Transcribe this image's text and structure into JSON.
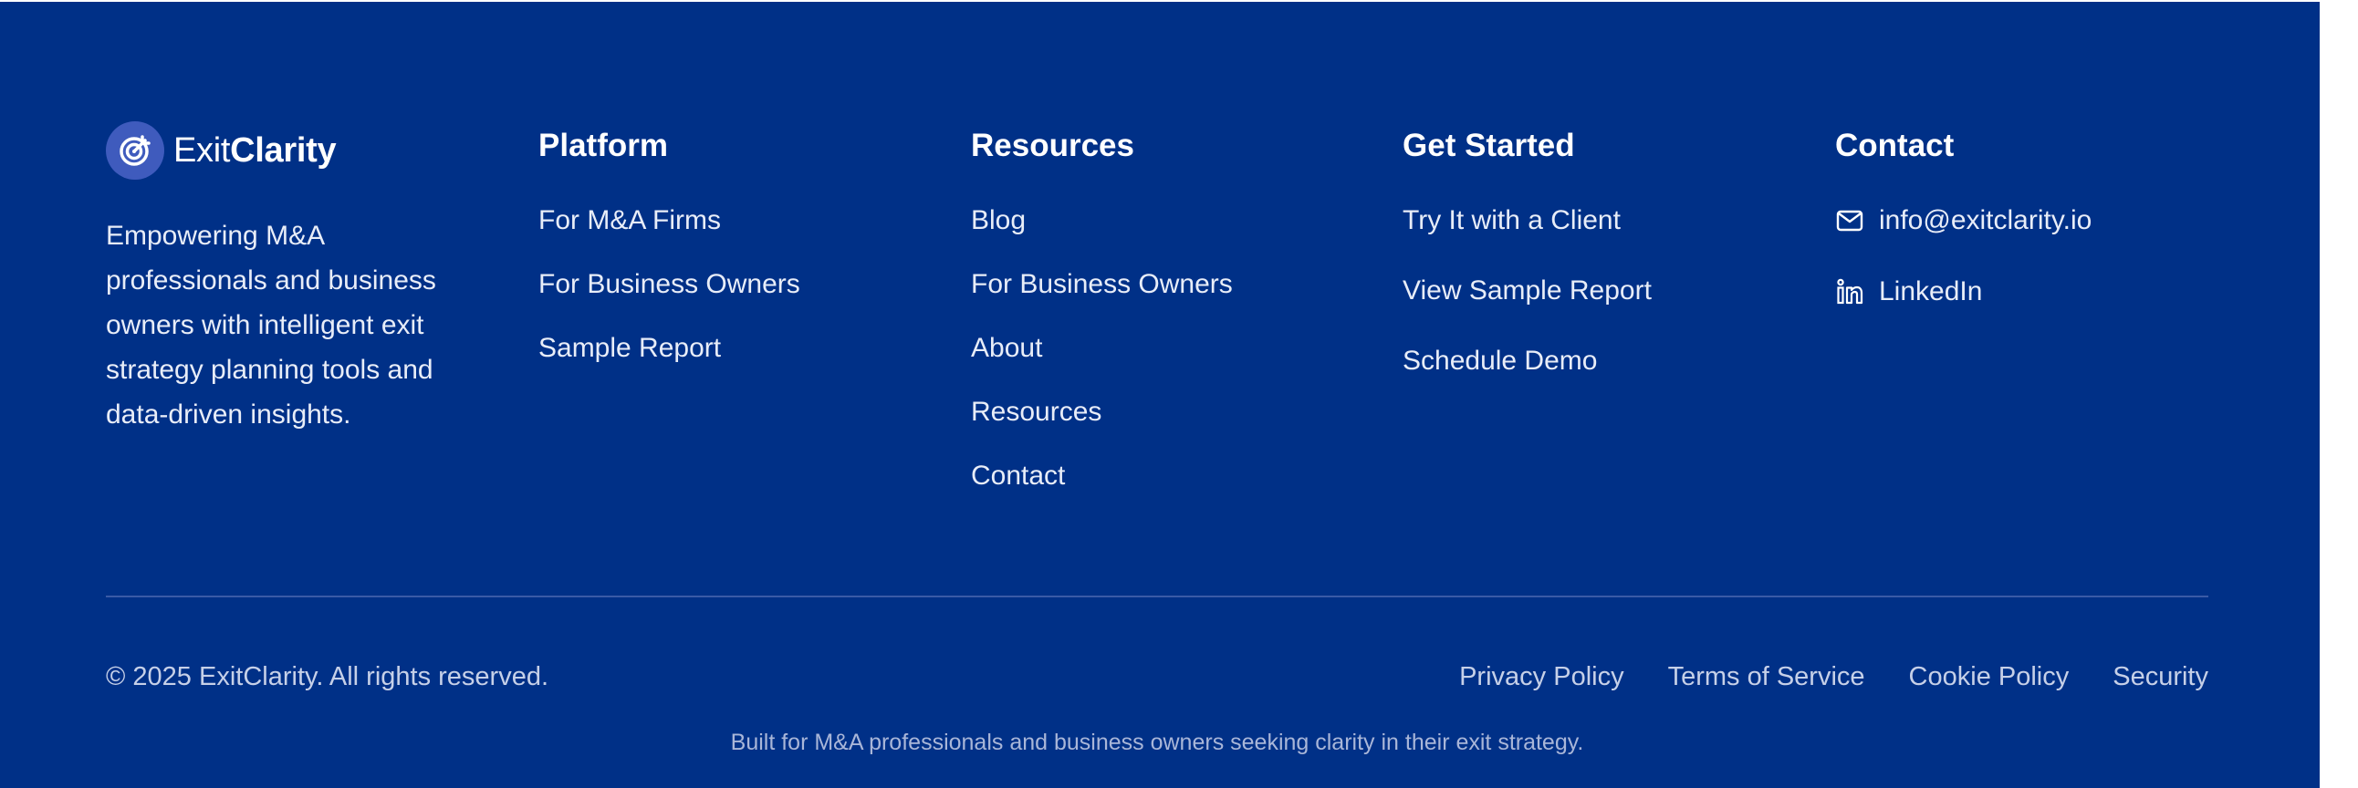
{
  "brand": {
    "name_light": "Exit",
    "name_bold": "Clarity",
    "icon": "target-icon",
    "tagline": "Empowering M&A professionals and business owners with intelligent exit strategy planning tools and data-driven insights."
  },
  "platform": {
    "title": "Platform",
    "links": [
      "For M&A Firms",
      "For Business Owners",
      "Sample Report"
    ]
  },
  "resources": {
    "title": "Resources",
    "links": [
      "Blog",
      "For Business Owners",
      "About",
      "Resources",
      "Contact"
    ]
  },
  "get_started": {
    "title": "Get Started",
    "links": [
      "Try It with a Client",
      "View Sample Report",
      "Schedule Demo"
    ]
  },
  "contact": {
    "title": "Contact",
    "email": "info@exitclarity.io",
    "email_icon": "mail-icon",
    "linkedin": "LinkedIn",
    "linkedin_icon": "linkedin-icon"
  },
  "bottom": {
    "copyright": "© 2025 ExitClarity. All rights reserved.",
    "legal_links": [
      "Privacy Policy",
      "Terms of Service",
      "Cookie Policy",
      "Security"
    ],
    "built_for": "Built for M&A professionals and business owners seeking clarity in their exit strategy."
  },
  "colors": {
    "background": "#003087",
    "logo_circle": "#3f5bbd",
    "text": "#ffffff",
    "muted_text": "#c6d0e8"
  }
}
